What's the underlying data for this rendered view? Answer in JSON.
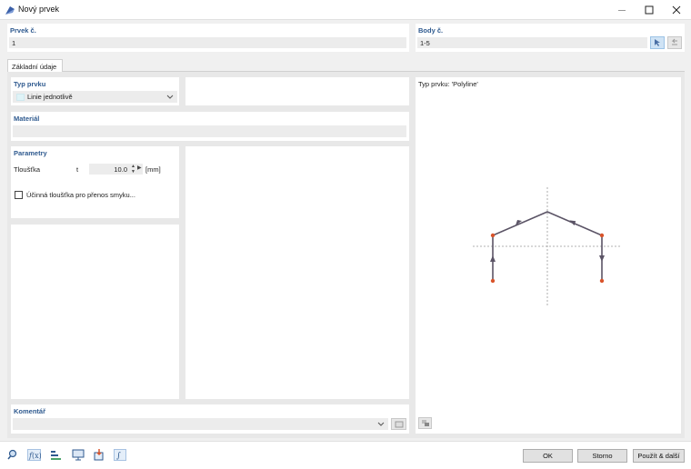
{
  "window": {
    "title": "Nový prvek",
    "minimize_icon": "minimize-icon",
    "maximize_icon": "maximize-icon",
    "close_icon": "close-icon"
  },
  "element_no": {
    "label": "Prvek č.",
    "value": "1"
  },
  "points_no": {
    "label": "Body č.",
    "value": "1-5"
  },
  "tabs": [
    {
      "label": "Základní údaje"
    }
  ],
  "element_type": {
    "label": "Typ prvku",
    "selected": "Linie jednotlivě"
  },
  "material": {
    "label": "Materiál",
    "value": ""
  },
  "parameters": {
    "label": "Parametry",
    "thickness_label": "Tloušťka",
    "thickness_symbol": "t",
    "thickness_value": "10.0",
    "thickness_unit": "[mm]",
    "checkbox_label": "Účinná tloušťka pro přenos smyku...",
    "checkbox_checked": false
  },
  "preview": {
    "title": "Typ prvku: 'Polyline'"
  },
  "comment": {
    "label": "Komentář",
    "value": ""
  },
  "buttons": {
    "ok": "OK",
    "cancel": "Storno",
    "apply_next": "Použít & další"
  },
  "colors": {
    "accent_blue": "#2f5a8f",
    "line": "#5b5466",
    "point": "#d9542b"
  }
}
